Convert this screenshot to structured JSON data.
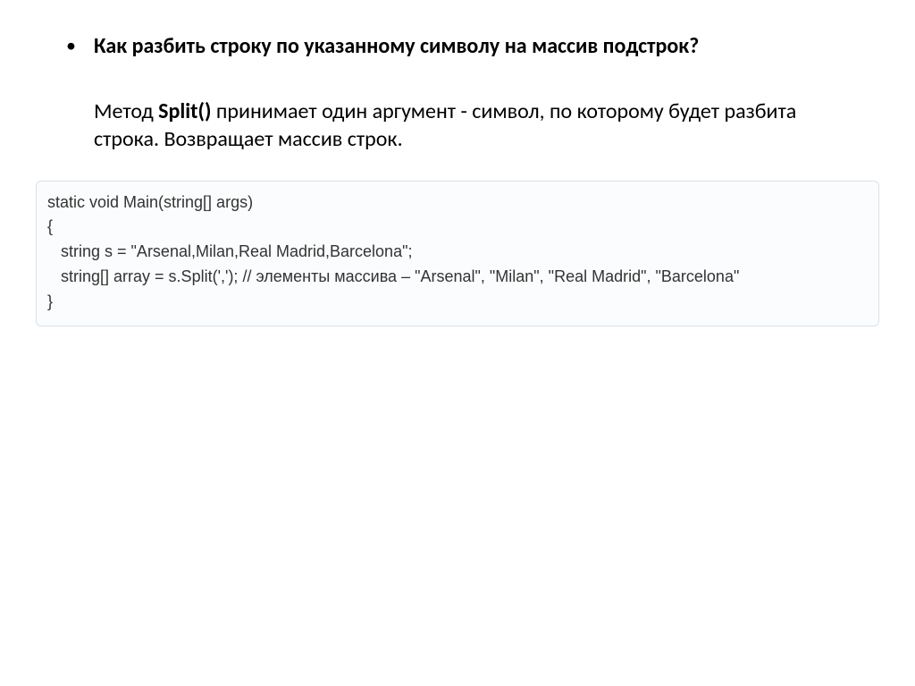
{
  "bullet": {
    "question": "Как разбить строку по указанному символу на массив подстрок?",
    "answer_before": "Метод ",
    "method": "Split() ",
    "answer_after": "принимает один аргумент - символ, по которому будет разбита строка. Возвращает массив строк."
  },
  "code": {
    "l1": "static void Main(string[] args)",
    "l2": "{",
    "l3": "   string s = \"Arsenal,Milan,Real Madrid,Barcelona\";",
    "l4": "   string[] array = s.Split(','); // элементы массива – \"Arsenal\", \"Milan\", \"Real Madrid\", \"Barcelona\"",
    "l5": "}"
  }
}
